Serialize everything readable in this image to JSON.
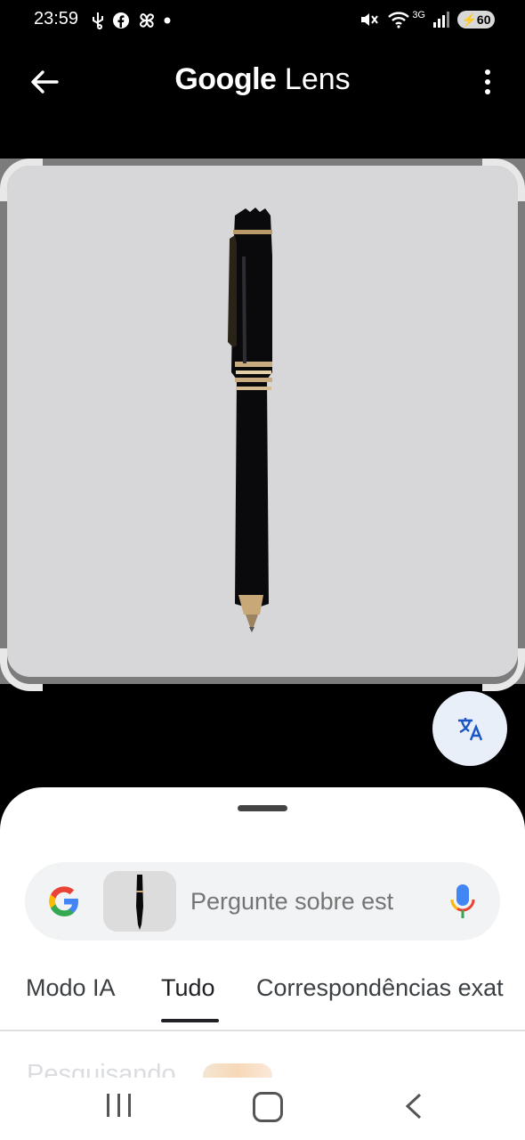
{
  "status_bar": {
    "time": "23:59",
    "network": "3G",
    "battery": "60",
    "icons": [
      "usb-icon",
      "facebook-icon",
      "pinwheel-icon",
      "dot-icon",
      "mute-icon",
      "wifi-icon",
      "signal-icon",
      "battery-icon"
    ]
  },
  "header": {
    "title_brand": "Google",
    "title_product": "Lens",
    "back_icon": "arrow-left-icon",
    "more_icon": "more-vert-icon"
  },
  "image": {
    "subject": "black fountain pen with gold trim",
    "background_color": "#d7d7d9"
  },
  "translate_button": {
    "icon": "translate-icon",
    "background": "#e9eff8"
  },
  "search": {
    "placeholder": "Pergunte sobre est",
    "mic_icon": "mic-icon"
  },
  "tabs": [
    {
      "label": "Modo IA",
      "active": false
    },
    {
      "label": "Tudo",
      "active": true
    },
    {
      "label": "Correspondências exat",
      "active": false
    }
  ],
  "status_text": "Pesquisando",
  "nav": {
    "recent_icon": "recent-apps-icon",
    "home_icon": "home-icon",
    "back_icon": "back-icon"
  },
  "colors": {
    "google_blue": "#4285F4",
    "google_red": "#EA4335",
    "google_yellow": "#FBBC05",
    "google_green": "#34A853"
  }
}
